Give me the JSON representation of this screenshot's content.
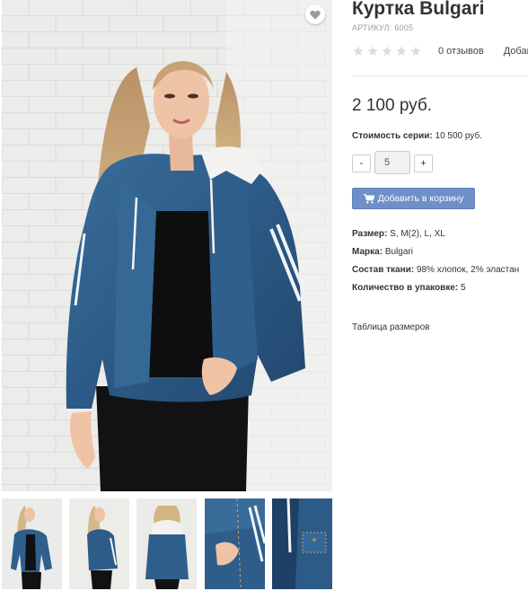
{
  "product": {
    "title": "Куртка Bulgari",
    "sku_label": "АРТИКУЛ:",
    "sku_value": "6005",
    "reviews_text": "0 отзывов",
    "add_review_text": "Добав",
    "price": "2 100 руб.",
    "series_label": "Стоимость серии:",
    "series_value": "10 500 руб.",
    "quantity": {
      "minus": "-",
      "value": "5",
      "plus": "+"
    },
    "add_to_cart_label": "Добавить в корзину",
    "properties": [
      {
        "label": "Размер:",
        "value": "S, M(2), L, XL"
      },
      {
        "label": "Марка:",
        "value": "Bulgari"
      },
      {
        "label": "Состав ткани:",
        "value": "98% хлопок, 2% эластан"
      },
      {
        "label": "Количество в упаковке:",
        "value": "5"
      }
    ],
    "size_table_link": "Таблица размеров"
  },
  "rating": {
    "stars_filled": 0,
    "stars_total": 5
  },
  "icons": {
    "wishlist": "heart-icon",
    "cart": "shopping-cart-icon",
    "star": "star-icon"
  },
  "colors": {
    "cart_button": "#6e8fc9",
    "star_empty": "#dcdcdc",
    "denim": "#2f5f8c"
  }
}
